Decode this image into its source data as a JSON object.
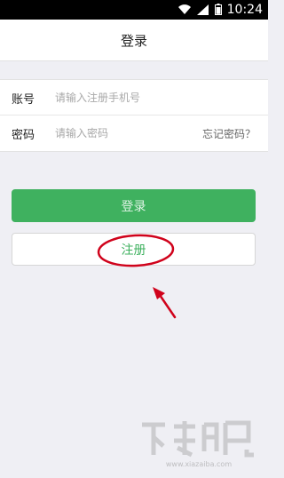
{
  "status_bar": {
    "time": "10:24"
  },
  "header": {
    "title": "登录"
  },
  "form": {
    "account_label": "账号",
    "account_placeholder": "请输入注册手机号",
    "password_label": "密码",
    "password_placeholder": "请输入密码",
    "forgot_label": "忘记密码？"
  },
  "actions": {
    "login_label": "登录",
    "register_label": "注册"
  },
  "colors": {
    "accent": "#3fb15f",
    "annotation": "#d0021b"
  },
  "watermark": {
    "text": "www.xiazaiba.com"
  }
}
